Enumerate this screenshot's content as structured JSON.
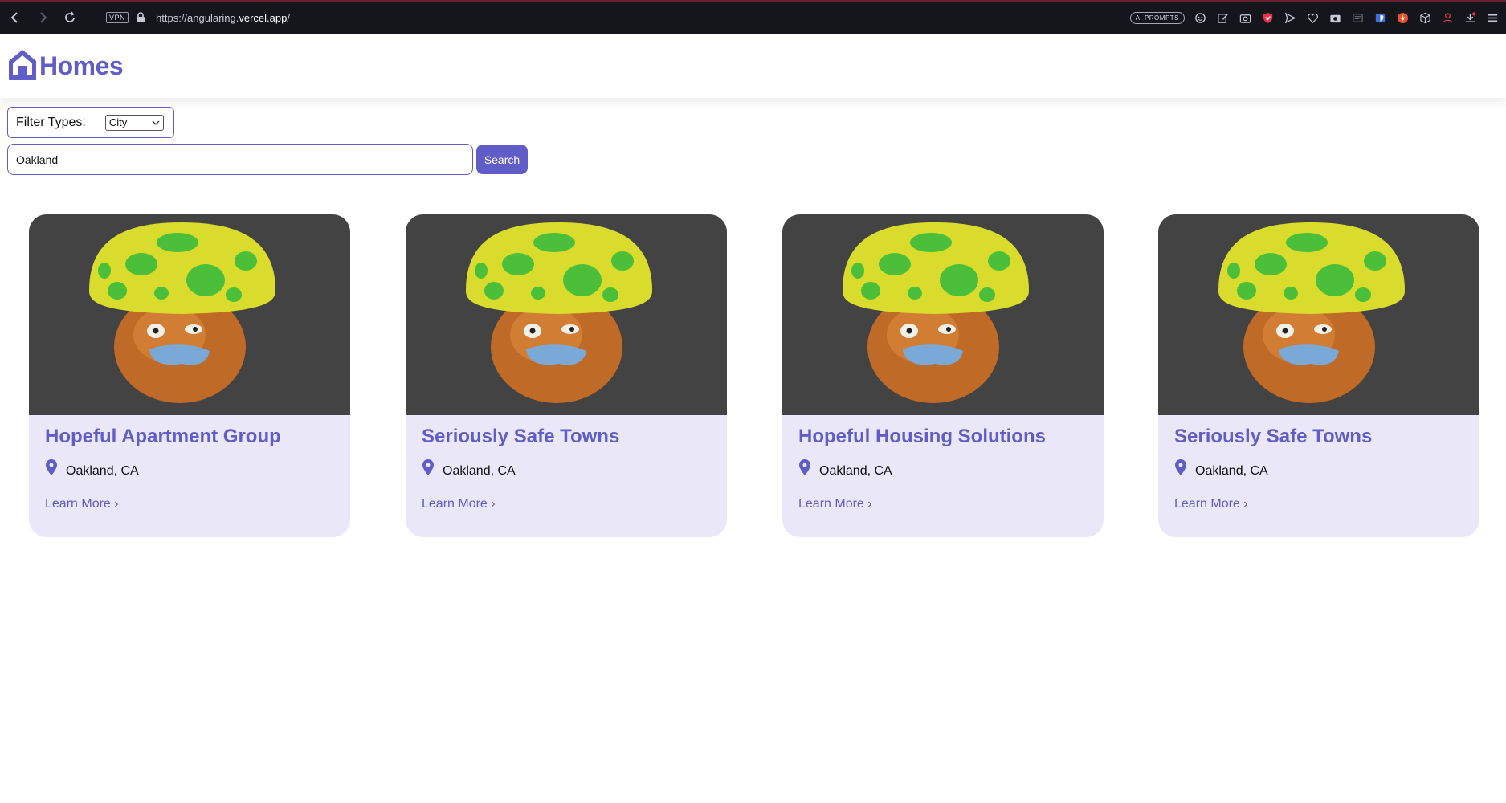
{
  "browser": {
    "vpn_label": "VPN",
    "url_prefix": "https://angularing.",
    "url_domain": "vercel.app",
    "url_suffix": "/",
    "ai_prompts_label": "AI PROMPTS"
  },
  "header": {
    "logo_text": "Homes",
    "brand_color": "#605dc8"
  },
  "filter": {
    "label": "Filter Types:",
    "selected": "City"
  },
  "search": {
    "value": "Oakland",
    "button_label": "Search"
  },
  "listings": [
    {
      "name": "Hopeful Apartment Group",
      "location": "Oakland, CA",
      "link": "Learn More ›"
    },
    {
      "name": "Seriously Safe Towns",
      "location": "Oakland, CA",
      "link": "Learn More ›"
    },
    {
      "name": "Hopeful Housing Solutions",
      "location": "Oakland, CA",
      "link": "Learn More ›"
    },
    {
      "name": "Seriously Safe Towns",
      "location": "Oakland, CA",
      "link": "Learn More ›"
    }
  ]
}
